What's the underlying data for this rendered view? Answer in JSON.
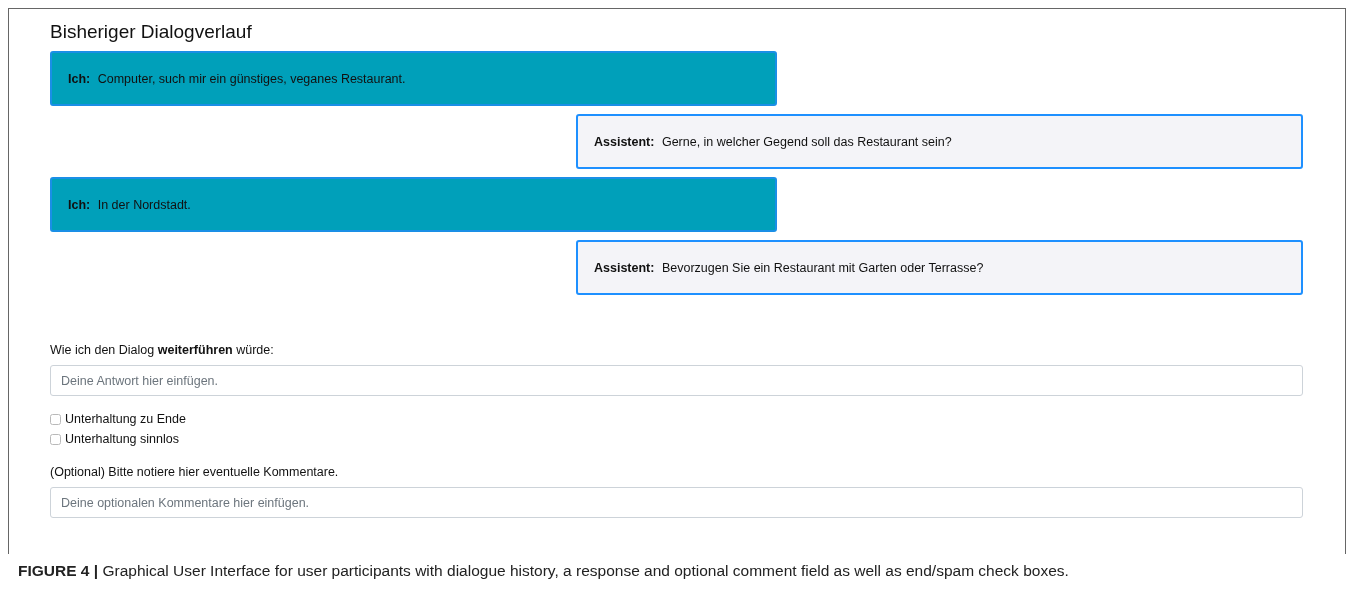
{
  "heading": "Bisheriger Dialogverlauf",
  "messages": [
    {
      "kind": "user",
      "speaker": "Ich:",
      "text": "Computer, such mir ein günstiges, veganes Restaurant."
    },
    {
      "kind": "assistant",
      "speaker": "Assistent:",
      "text": "Gerne, in welcher Gegend soll das Restaurant sein?"
    },
    {
      "kind": "user",
      "speaker": "Ich:",
      "text": "In der Nordstadt."
    },
    {
      "kind": "assistant",
      "speaker": "Assistent:",
      "text": "Bevorzugen Sie ein Restaurant mit Garten oder Terrasse?"
    }
  ],
  "response": {
    "label": "Wie ich den Dialog **weiterführen** würde:",
    "placeholder": "Deine Antwort hier einfügen."
  },
  "checkboxes": [
    {
      "label": "Unterhaltung zu Ende",
      "checked": false
    },
    {
      "label": "Unterhaltung sinnlos",
      "checked": false
    }
  ],
  "comment": {
    "label": "(Optional) Bitte notiere hier eventuelle Kommentare.",
    "placeholder": "Deine optionalen Kommentare hier einfügen."
  },
  "caption": "**FIGURE 4 |** Graphical User Interface for user participants with dialogue history, a response and optional comment field as well as end/spam check boxes."
}
